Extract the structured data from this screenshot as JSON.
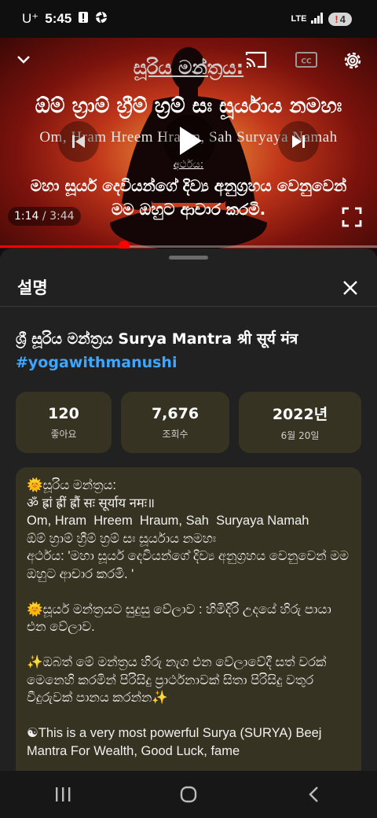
{
  "status_bar": {
    "carrier": "U⁺",
    "time": "5:45",
    "network": "LTE",
    "battery_level": "4",
    "battery_alert": "!"
  },
  "player": {
    "overlay": {
      "title": "සූරිය මන්ත්‍රය:",
      "sinhala_mantra": "ඕම් හ්‍රාම් හ්‍රීම් හ්‍රම් සඃ සූර්යාය නමහඃ",
      "roman_mantra": "Om, Hram  Hreem  Hraum, Sah  Suryaya  Namah",
      "meaning_label": "අර්ථය:",
      "meaning_line1": "මහා සූර්ය දෙවියන්ගේ දිව්‍ය අනුග්‍රහය වෙනුවෙන්",
      "meaning_line2": "මම ඔහුට ආචාර කරමි."
    },
    "current_time": "1:14",
    "separator": " / ",
    "duration": "3:44",
    "progress": 0.33,
    "accent_color": "#ff0000",
    "icons": [
      "chevron-down-icon",
      "cast-icon",
      "captions-icon",
      "settings-icon",
      "previous-icon",
      "play-icon",
      "next-icon",
      "fullscreen-icon"
    ]
  },
  "description_panel": {
    "title": "설명",
    "video_title": "ශ්‍රී සූරිය මන්ත්‍රය Surya Mantra  श्री सूर्य मंत्र ",
    "hashtag": "#yogawithmanushi",
    "stats": [
      {
        "value": "120",
        "label": "좋아요"
      },
      {
        "value": "7,676",
        "label": "조회수"
      },
      {
        "value": "2022년",
        "label": "6월 20일"
      }
    ],
    "description": "🌞සූරිය මන්ත්‍රය:\nॐ ह्रां ह्रीं ह्रौं सः सूर्याय नमः॥\nOm, Hram  Hreem  Hraum, Sah  Suryaya Namah\nඕම් හ්‍රාම් හ්‍රීම් හ්‍රම් සඃ සූර්යාය නමහඃ\nඅර්ථය: 'මහා සූර්ය දෙවියන්ගේ දිව්‍ය අනුග්‍රහය වෙනුවෙන් මම ඔහුට ආචාර කරමි. '\n\n🌞සූර්ය මන්ත්‍රයට සුදුසු වේලාව : හිමිදිරි උදයේ හිරු පායා එන වේලාව.\n\n✨ඔබත් මේ මන්ත්‍රය හිරු නැග එන වේලාවේදී සත් වරක් මෙනෙහි කරමින් පිරිසිදු ප්‍රාර්ථනාවක් සිතා පිරිසිදු වතුර වීදුරුවක් පානය කරන්න✨\n\n☯This is a very most powerful Surya (SURYA) Beej Mantra For Wealth, Good Luck, fame"
  },
  "nav_bar": {
    "icons": [
      "recent-apps-icon",
      "home-icon",
      "back-icon"
    ]
  }
}
